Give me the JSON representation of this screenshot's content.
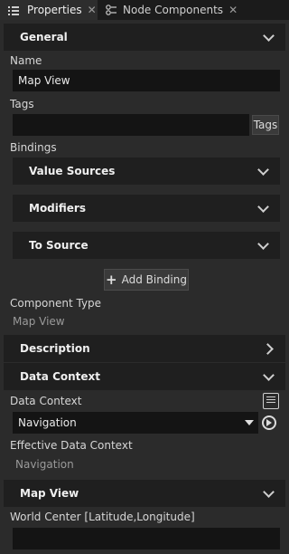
{
  "tabs": [
    {
      "label": "Properties",
      "icon": "properties-icon",
      "active": true
    },
    {
      "label": "Node Components",
      "icon": "node-components-icon",
      "active": false
    }
  ],
  "sections": {
    "general": {
      "title": "General"
    },
    "description": {
      "title": "Description"
    },
    "data_context": {
      "title": "Data Context"
    },
    "map_view": {
      "title": "Map View"
    }
  },
  "name": {
    "label": "Name",
    "value": "Map View"
  },
  "tags": {
    "label": "Tags",
    "value": "",
    "button": "Tags"
  },
  "bindings": {
    "label": "Bindings",
    "groups": [
      {
        "title": "Value Sources"
      },
      {
        "title": "Modifiers"
      },
      {
        "title": "To Source"
      }
    ],
    "add_label": "Add Binding"
  },
  "component_type": {
    "label": "Component Type",
    "value": "Map View"
  },
  "data_context": {
    "label": "Data Context",
    "value": "Navigation"
  },
  "effective_data_context": {
    "label": "Effective Data Context",
    "value": "Navigation"
  },
  "world_center": {
    "label": "World Center [Latitude,Longitude]",
    "value": ""
  },
  "colors": {
    "background": "#2b2b2b",
    "header": "#1f1f1f",
    "input": "#141414"
  }
}
